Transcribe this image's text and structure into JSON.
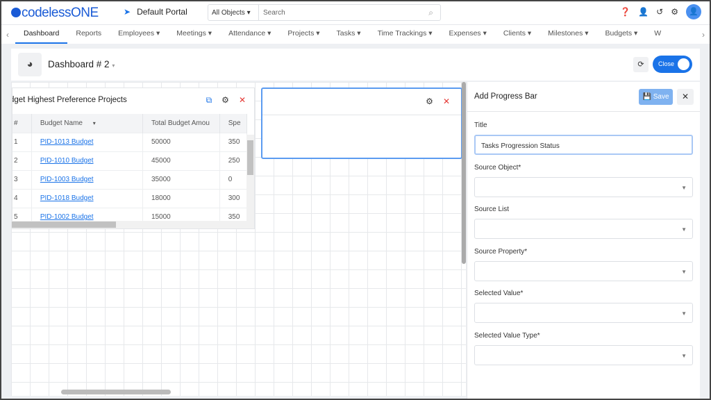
{
  "header": {
    "logo": "codelessONE",
    "portal": "Default Portal",
    "search_scope": "All Objects",
    "search_placeholder": "Search"
  },
  "nav": {
    "items": [
      {
        "label": "Dashboard",
        "active": true
      },
      {
        "label": "Reports"
      },
      {
        "label": "Employees ▾"
      },
      {
        "label": "Meetings ▾"
      },
      {
        "label": "Attendance ▾"
      },
      {
        "label": "Projects ▾"
      },
      {
        "label": "Tasks ▾"
      },
      {
        "label": "Time Trackings ▾"
      },
      {
        "label": "Expenses ▾"
      },
      {
        "label": "Clients ▾"
      },
      {
        "label": "Milestones ▾"
      },
      {
        "label": "Budgets ▾"
      },
      {
        "label": "W"
      }
    ]
  },
  "dashboard": {
    "title": "Dashboard # 2",
    "close_label": "Close"
  },
  "widget1": {
    "title": "dget Highest Preference Projects",
    "columns": [
      "#",
      "Budget Name",
      "Total Budget Amou",
      "Spe"
    ],
    "rows": [
      [
        "1",
        "PID-1013 Budget",
        "50000",
        "350"
      ],
      [
        "2",
        "PID-1010 Budget",
        "45000",
        "250"
      ],
      [
        "3",
        "PID-1003 Budget",
        "35000",
        "0"
      ],
      [
        "4",
        "PID-1018 Budget",
        "18000",
        "300"
      ],
      [
        "5",
        "PID-1002 Budget",
        "15000",
        "350"
      ]
    ]
  },
  "panel": {
    "title": "Add Progress Bar",
    "save_label": "Save",
    "fields": [
      {
        "label": "Title",
        "value": "Tasks Progression Status"
      },
      {
        "label": "Source Object*",
        "value": ""
      },
      {
        "label": "Source List",
        "value": ""
      },
      {
        "label": "Source Property*",
        "value": ""
      },
      {
        "label": "Selected Value*",
        "value": ""
      },
      {
        "label": "Selected Value Type*",
        "value": ""
      }
    ]
  },
  "colors": {
    "accent": "#1a73e8",
    "close_red": "#e53935"
  }
}
